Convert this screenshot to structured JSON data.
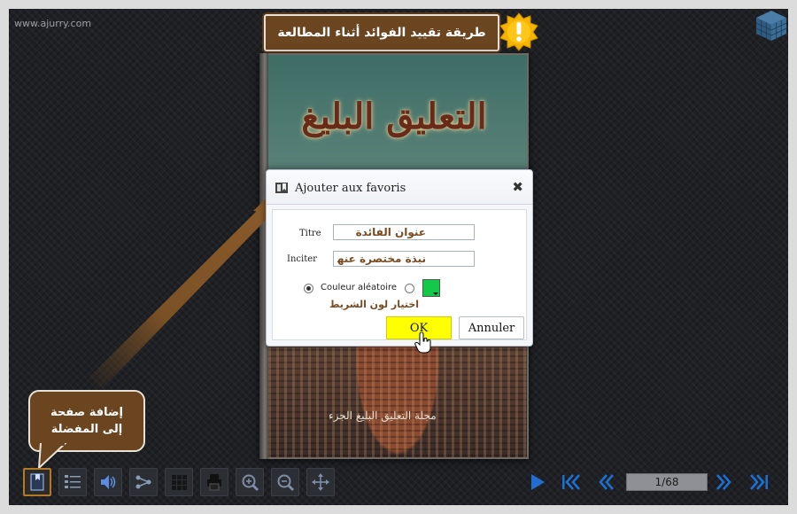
{
  "site": {
    "url": "www.ajurry.com"
  },
  "banner": {
    "text": "طريقة تقييد الفوائد أثناء المطالعة",
    "icon": "warning-icon",
    "color": "#6b4520"
  },
  "book": {
    "title": "التعليق البليغ",
    "subtitle": "مجلة التعليق البليغ الجزء"
  },
  "dialog": {
    "title": "Ajouter aux favoris",
    "close_label": "✖",
    "fields": {
      "title_label": "Titre",
      "title_value": "عنوان الفائدة",
      "excerpt_label": "Inciter",
      "excerpt_value": "نبذة مختصرة عنها"
    },
    "color": {
      "random_label": "Couleur aléatoire",
      "random_selected": true,
      "custom_selected": false,
      "swatch_color": "#14c84a",
      "hint": "اختيار لون الشريط"
    },
    "ok_label": "OK",
    "cancel_label": "Annuler"
  },
  "callout": {
    "line1": "إضافة صفحة",
    "line2": "إلى المفضلة"
  },
  "toolbar": {
    "buttons": [
      "bookmark-icon",
      "toc-icon",
      "sound-icon",
      "share-icon",
      "thumbnails-icon",
      "print-icon",
      "zoom-in-icon",
      "zoom-out-icon",
      "move-icon"
    ],
    "active": "bookmark-icon"
  },
  "navigation": {
    "page_indicator": "1/68"
  },
  "colors": {
    "accent_blue": "#1f6fd0",
    "brand_brown": "#6b4520",
    "ok_yellow": "#ffff00"
  }
}
